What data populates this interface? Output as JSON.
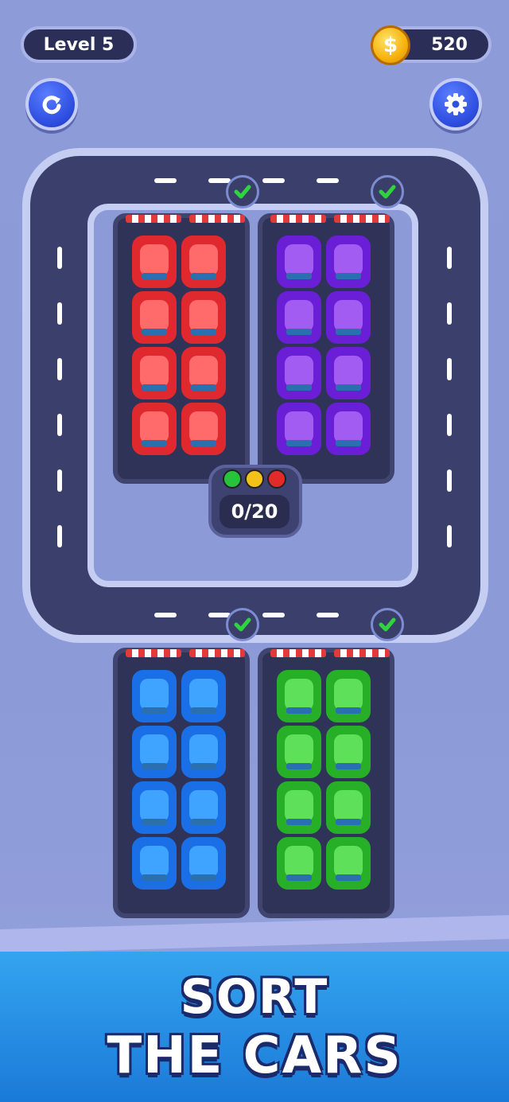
{
  "hud": {
    "level_label": "Level 5",
    "coins": "520",
    "coin_symbol": "$"
  },
  "counter": {
    "text": "0/20",
    "lights": [
      "#27c33a",
      "#f2c21b",
      "#e22a2a"
    ]
  },
  "lots": [
    {
      "color": "#e0282f",
      "roof": "#ff6a6a",
      "cars": 8,
      "checked": true
    },
    {
      "color": "#6a1fd6",
      "roof": "#a35cf2",
      "cars": 8,
      "checked": true
    },
    {
      "color": "#1a6fe6",
      "roof": "#3ea4ff",
      "cars": 8,
      "checked": true
    },
    {
      "color": "#27b027",
      "roof": "#5ee05a",
      "cars": 8,
      "checked": true
    }
  ],
  "banner": {
    "line1": "SORT",
    "line2": "THE CARS"
  },
  "icons": {
    "restart": "restart-icon",
    "settings": "gear-icon",
    "check": "checkmark-icon"
  }
}
